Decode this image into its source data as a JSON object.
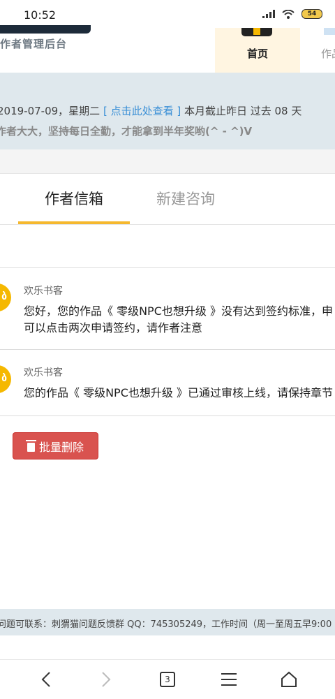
{
  "status_bar": {
    "time": "10:52",
    "battery": "54"
  },
  "header": {
    "logo_subtitle": "作者管理后台",
    "nav_home_label": "首页",
    "nav_works_label": "作品"
  },
  "notice": {
    "date_text": "2019-07-09，星期二 ",
    "link_text": "[ 点击此处查看 ]",
    "summary_text": " 本月截止昨日 过去 08 天",
    "encouragement": "作者大大，坚持每日全勤，才能拿到半年奖哟(^ - ^)V"
  },
  "tabs": {
    "inbox": "作者信箱",
    "new_inquiry": "新建咨询"
  },
  "messages": [
    {
      "sender": "欢乐书客",
      "body": "您好，您的作品《 零级NPC也想升级 》没有达到签约标准，申\n可以点击两次申请签约，请作者注意"
    },
    {
      "sender": "欢乐书客",
      "body": "您的作品《 零级NPC也想升级 》已通过审核上线，请保持章节"
    }
  ],
  "actions": {
    "batch_delete": "批量删除"
  },
  "footer": {
    "contact": "问题可联系：刺猬猫问题反馈群 QQ：745305249，工作时间（周一至周五早9:00"
  },
  "browser_nav": {
    "tab_count": "3"
  },
  "colors": {
    "accent": "#f5b82e",
    "danger": "#d9534f",
    "link": "#3a8fd6",
    "notice_bg": "#dfe8ed"
  },
  "icons": [
    "signal-icon",
    "wifi-icon",
    "battery-icon",
    "trash-icon",
    "back-icon",
    "forward-icon",
    "tabs-icon",
    "menu-icon",
    "home-icon"
  ]
}
